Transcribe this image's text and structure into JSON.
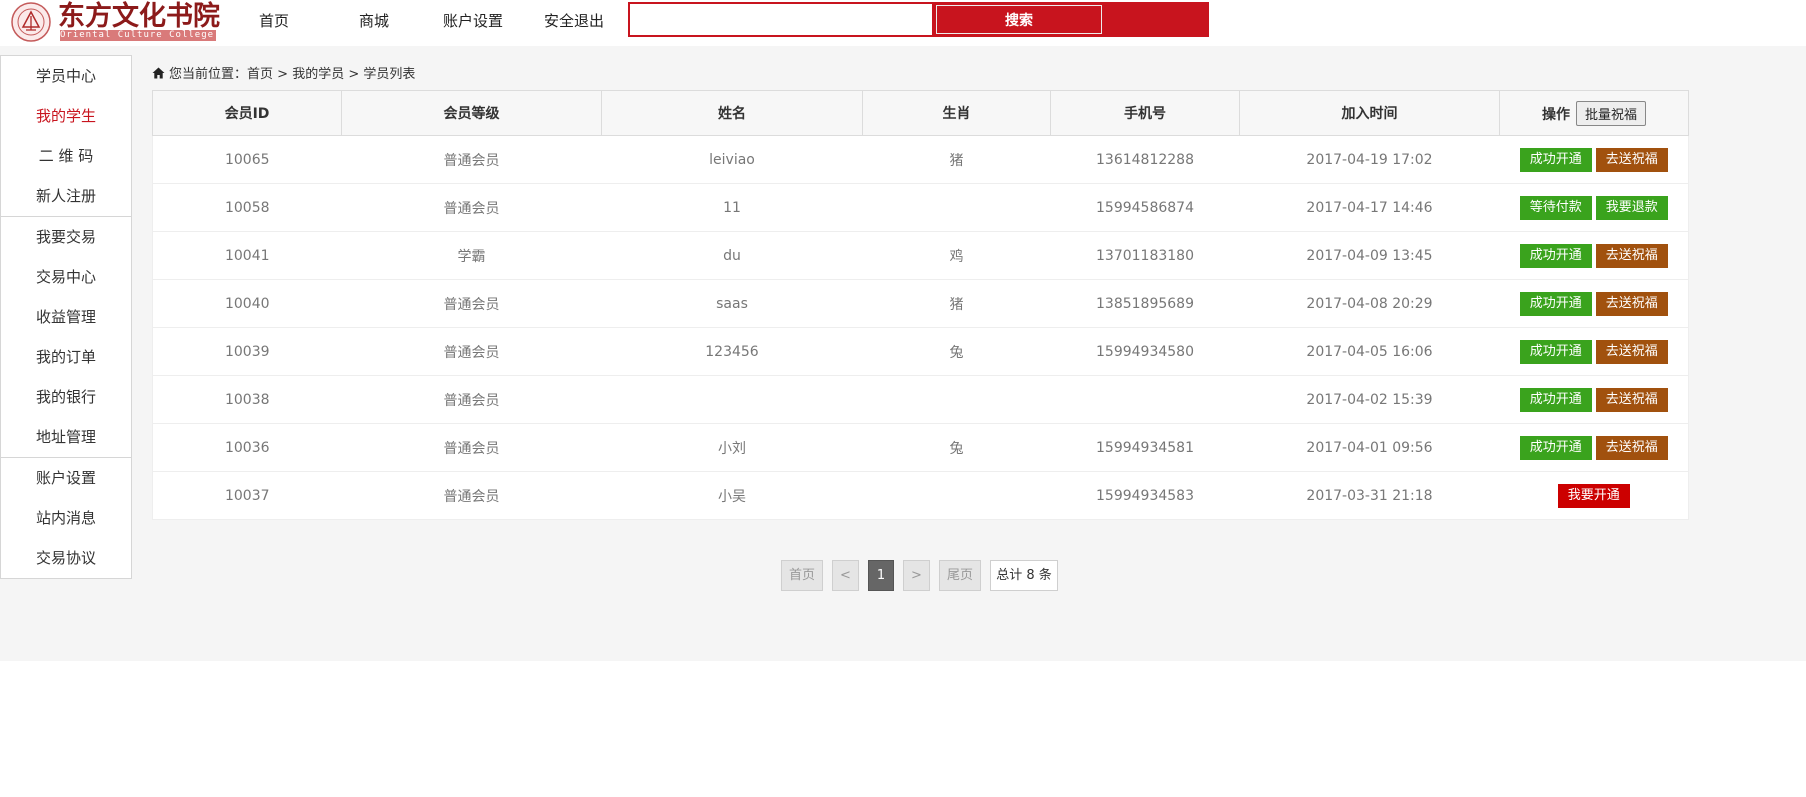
{
  "header": {
    "brand_cn": "东方文化书院",
    "brand_en": "Oriental Culture College",
    "nav": [
      "首页",
      "商城",
      "账户设置",
      "安全退出"
    ],
    "search_value": "",
    "search_button": "搜索"
  },
  "sidebar": {
    "groups": [
      [
        "学员中心",
        "我的学生",
        "二 维 码",
        "新人注册"
      ],
      [
        "我要交易",
        "交易中心",
        "收益管理",
        "我的订单",
        "我的银行",
        "地址管理"
      ],
      [
        "账户设置",
        "站内消息",
        "交易协议"
      ]
    ],
    "active": "我的学生"
  },
  "breadcrumb": {
    "prefix": "您当前位置：",
    "items": [
      "首页",
      "我的学员",
      "学员列表"
    ],
    "separator": " > "
  },
  "table": {
    "headers": [
      "会员ID",
      "会员等级",
      "姓名",
      "生肖",
      "手机号",
      "加入时间",
      "操作"
    ],
    "batch_button": "批量祝福",
    "rows": [
      {
        "id": "10065",
        "level": "普通会员",
        "name": "leiviao",
        "zodiac": "猪",
        "phone": "13614812288",
        "time": "2017-04-19 17:02",
        "actions": [
          "成功开通",
          "去送祝福"
        ]
      },
      {
        "id": "10058",
        "level": "普通会员",
        "name": "11",
        "zodiac": "",
        "phone": "15994586874",
        "time": "2017-04-17 14:46",
        "actions": [
          "等待付款",
          "我要退款"
        ]
      },
      {
        "id": "10041",
        "level": "学霸",
        "name": "du",
        "zodiac": "鸡",
        "phone": "13701183180",
        "time": "2017-04-09 13:45",
        "actions": [
          "成功开通",
          "去送祝福"
        ]
      },
      {
        "id": "10040",
        "level": "普通会员",
        "name": "saas",
        "zodiac": "猪",
        "phone": "13851895689",
        "time": "2017-04-08 20:29",
        "actions": [
          "成功开通",
          "去送祝福"
        ]
      },
      {
        "id": "10039",
        "level": "普通会员",
        "name": "123456",
        "zodiac": "兔",
        "phone": "15994934580",
        "time": "2017-04-05 16:06",
        "actions": [
          "成功开通",
          "去送祝福"
        ]
      },
      {
        "id": "10038",
        "level": "普通会员",
        "name": "",
        "zodiac": "",
        "phone": "",
        "time": "2017-04-02 15:39",
        "actions": [
          "成功开通",
          "去送祝福"
        ]
      },
      {
        "id": "10036",
        "level": "普通会员",
        "name": "小刘",
        "zodiac": "兔",
        "phone": "15994934581",
        "time": "2017-04-01 09:56",
        "actions": [
          "成功开通",
          "去送祝福"
        ]
      },
      {
        "id": "10037",
        "level": "普通会员",
        "name": "小吴",
        "zodiac": "",
        "phone": "15994934583",
        "time": "2017-03-31 21:18",
        "actions": [
          "我要开通"
        ]
      }
    ]
  },
  "pagination": {
    "first": "首页",
    "prev": "<",
    "current": "1",
    "next": ">",
    "last": "尾页",
    "total": "总计 8 条"
  },
  "colors": {
    "brand_red": "#c8141e",
    "action_green": "#3aa31d",
    "action_brown": "#a1510e",
    "action_red": "#cc0000"
  }
}
